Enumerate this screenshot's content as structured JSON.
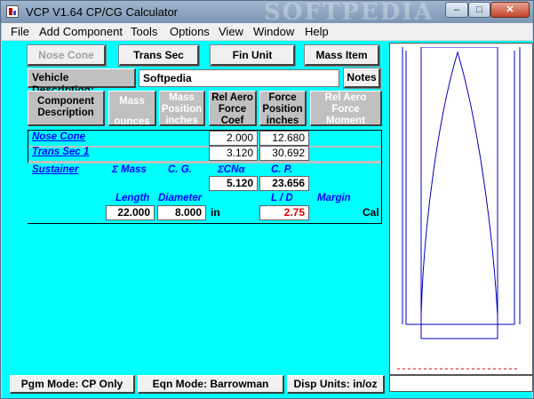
{
  "window": {
    "title": "VCP V1.64 CP/CG Calculator",
    "watermark": "SOFTPEDIA",
    "controls": {
      "minimize": "–",
      "maximize": "□",
      "close": "✕"
    }
  },
  "menu": [
    "File",
    "Add Component",
    "Tools",
    "Options",
    "View",
    "Window",
    "Help"
  ],
  "toolbar": {
    "nose_cone": "Nose Cone",
    "trans_sec": "Trans Sec",
    "fin_unit": "Fin Unit",
    "mass_item": "Mass Item"
  },
  "vehicle": {
    "label": "Vehicle Description:",
    "value": "Softpedia",
    "notes": "Notes"
  },
  "headers": {
    "component": [
      "Component",
      "Description"
    ],
    "mass": [
      "Mass",
      "ounces"
    ],
    "mass_position": [
      "Mass",
      "Position",
      "inches"
    ],
    "rel_aero_force": [
      "Rel Aero",
      "Force",
      "Coef"
    ],
    "force_position": [
      "Force",
      "Position",
      "inches"
    ],
    "rel_aero_moment": [
      "Rel Aero",
      "Force",
      "Moment"
    ]
  },
  "components": [
    {
      "name": "Nose Cone",
      "coef": "2.000",
      "position": "12.680"
    },
    {
      "name": "Trans Sec 1",
      "coef": "3.120",
      "position": "30.692"
    }
  ],
  "sustainer": {
    "label": "Sustainer",
    "sum_mass_label": "Σ Mass",
    "cg_label": "C. G.",
    "sum_cna_label": "ΣCNα",
    "cp_label": "C. P.",
    "sum_cna": "5.120",
    "cp": "23.656",
    "length_label": "Length",
    "diameter_label": "Diameter",
    "ld_label": "L / D",
    "margin_label": "Margin",
    "length": "22.000",
    "diameter": "8.000",
    "unit": "in",
    "ld": "2.75",
    "margin_unit": "Cal"
  },
  "status": {
    "pgm_mode": "Pgm Mode: CP Only",
    "eqn_mode": "Eqn Mode: Barrowman",
    "disp_units": "Disp Units: in/oz"
  },
  "colors": {
    "background": "#00ffff",
    "link": "#0000ff",
    "alert": "#e00000",
    "rocket_outline": "#0000c0"
  }
}
